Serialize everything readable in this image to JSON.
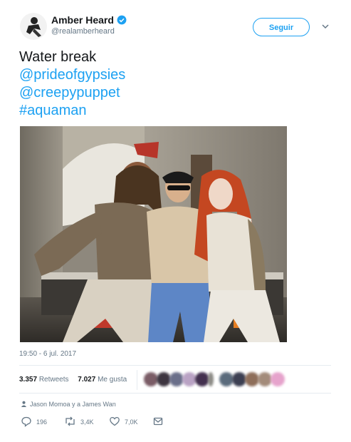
{
  "author": {
    "display_name": "Amber Heard",
    "handle": "@realamberheard",
    "avatar_icon": "user-avatar-icon",
    "verified_icon": "verified-badge-icon"
  },
  "follow_button": {
    "label": "Seguir"
  },
  "tweet": {
    "line1": "Water break",
    "mention1": "@prideofgypsies",
    "mention2": "@creepypuppet",
    "hashtag": "#aquaman"
  },
  "timestamp": "19:50 - 6 jul. 2017",
  "stats": {
    "retweets_count": "3.357",
    "retweets_label": "Retweets",
    "likes_count": "7.027",
    "likes_label": "Me gusta"
  },
  "followed_by": "Jason Momoa y a James Wan",
  "actions": {
    "reply_count": "196",
    "retweet_count": "3,4K",
    "like_count": "7,0K"
  },
  "colors": {
    "accent": "#1da1f2",
    "text": "#14171a",
    "muted": "#657786"
  }
}
